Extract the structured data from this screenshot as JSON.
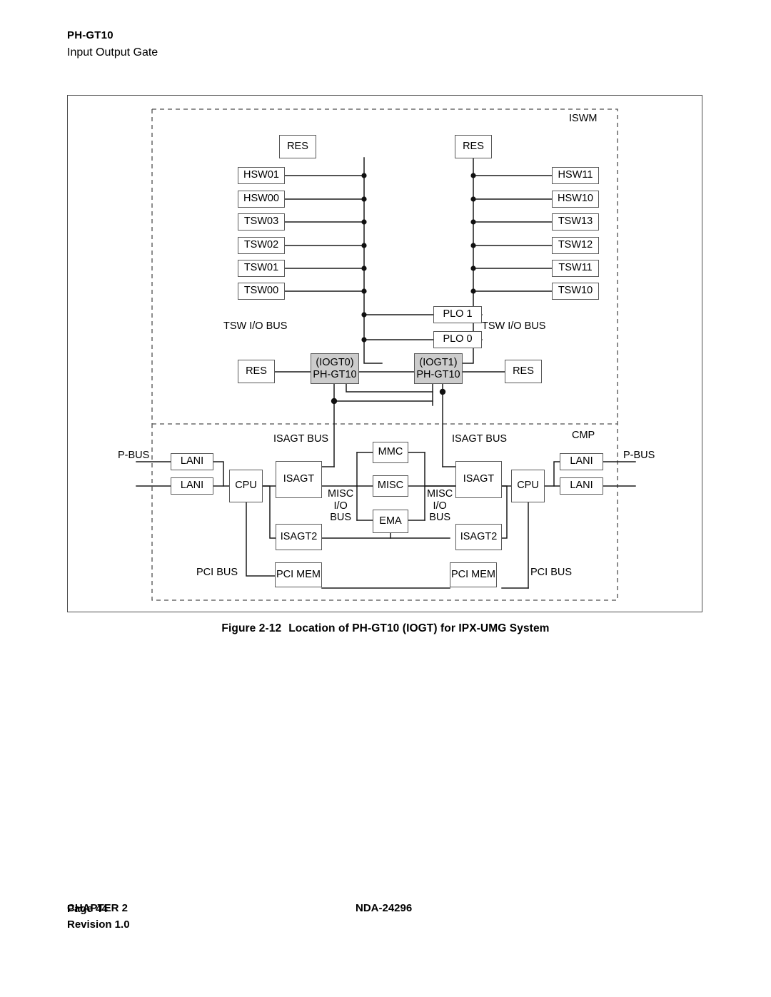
{
  "header": {
    "code": "PH-GT10",
    "subtitle": "Input Output Gate"
  },
  "figure": {
    "caption_number": "Figure 2-12",
    "caption_text": "Location of PH-GT10 (IOGT) for IPX-UMG System",
    "enclosures": [
      {
        "name": "iswm",
        "label": "ISWM"
      },
      {
        "name": "cmp",
        "label": "CMP"
      }
    ],
    "nodes": {
      "res_top_left": "RES",
      "res_top_right": "RES",
      "hsw01": "HSW01",
      "hsw00": "HSW00",
      "tsw03": "TSW03",
      "tsw02": "TSW02",
      "tsw01": "TSW01",
      "tsw00": "TSW00",
      "hsw11": "HSW11",
      "hsw10": "HSW10",
      "tsw13": "TSW13",
      "tsw12": "TSW12",
      "tsw11": "TSW11",
      "tsw10": "TSW10",
      "plo1": "PLO 1",
      "plo0": "PLO 0",
      "res_mid_left": "RES",
      "res_mid_right": "RES",
      "iogt0_line1": "(IOGT0)",
      "iogt0_line2": "PH-GT10",
      "iogt1_line1": "(IOGT1)",
      "iogt1_line2": "PH-GT10",
      "lani_l_top": "LANI",
      "lani_l_bottom": "LANI",
      "cpu_left": "CPU",
      "isagt_left": "ISAGT",
      "isagt2_left": "ISAGT2",
      "pcimem_left": "PCI MEM",
      "mmc": "MMC",
      "misc": "MISC",
      "ema": "EMA",
      "isagt_right": "ISAGT",
      "isagt2_right": "ISAGT2",
      "pcimem_right": "PCI MEM",
      "cpu_right": "CPU",
      "lani_r_top": "LANI",
      "lani_r_bottom": "LANI"
    },
    "bus_labels": {
      "tsw_io_bus_left": "TSW I/O BUS",
      "tsw_io_bus_right": "TSW I/O BUS",
      "isagt_bus_left": "ISAGT BUS",
      "isagt_bus_right": "ISAGT BUS",
      "p_bus_left": "P-BUS",
      "p_bus_right": "P-BUS",
      "pci_bus_left": "PCI BUS",
      "pci_bus_right": "PCI BUS",
      "misc_io_bus_left": [
        "MISC",
        "I/O",
        "BUS"
      ],
      "misc_io_bus_right": [
        "MISC",
        "I/O",
        "BUS"
      ]
    }
  },
  "footer": {
    "chapter": "CHAPTER 2",
    "document_number": "NDA-24296",
    "page": "Page 44",
    "revision": "Revision 1.0"
  }
}
